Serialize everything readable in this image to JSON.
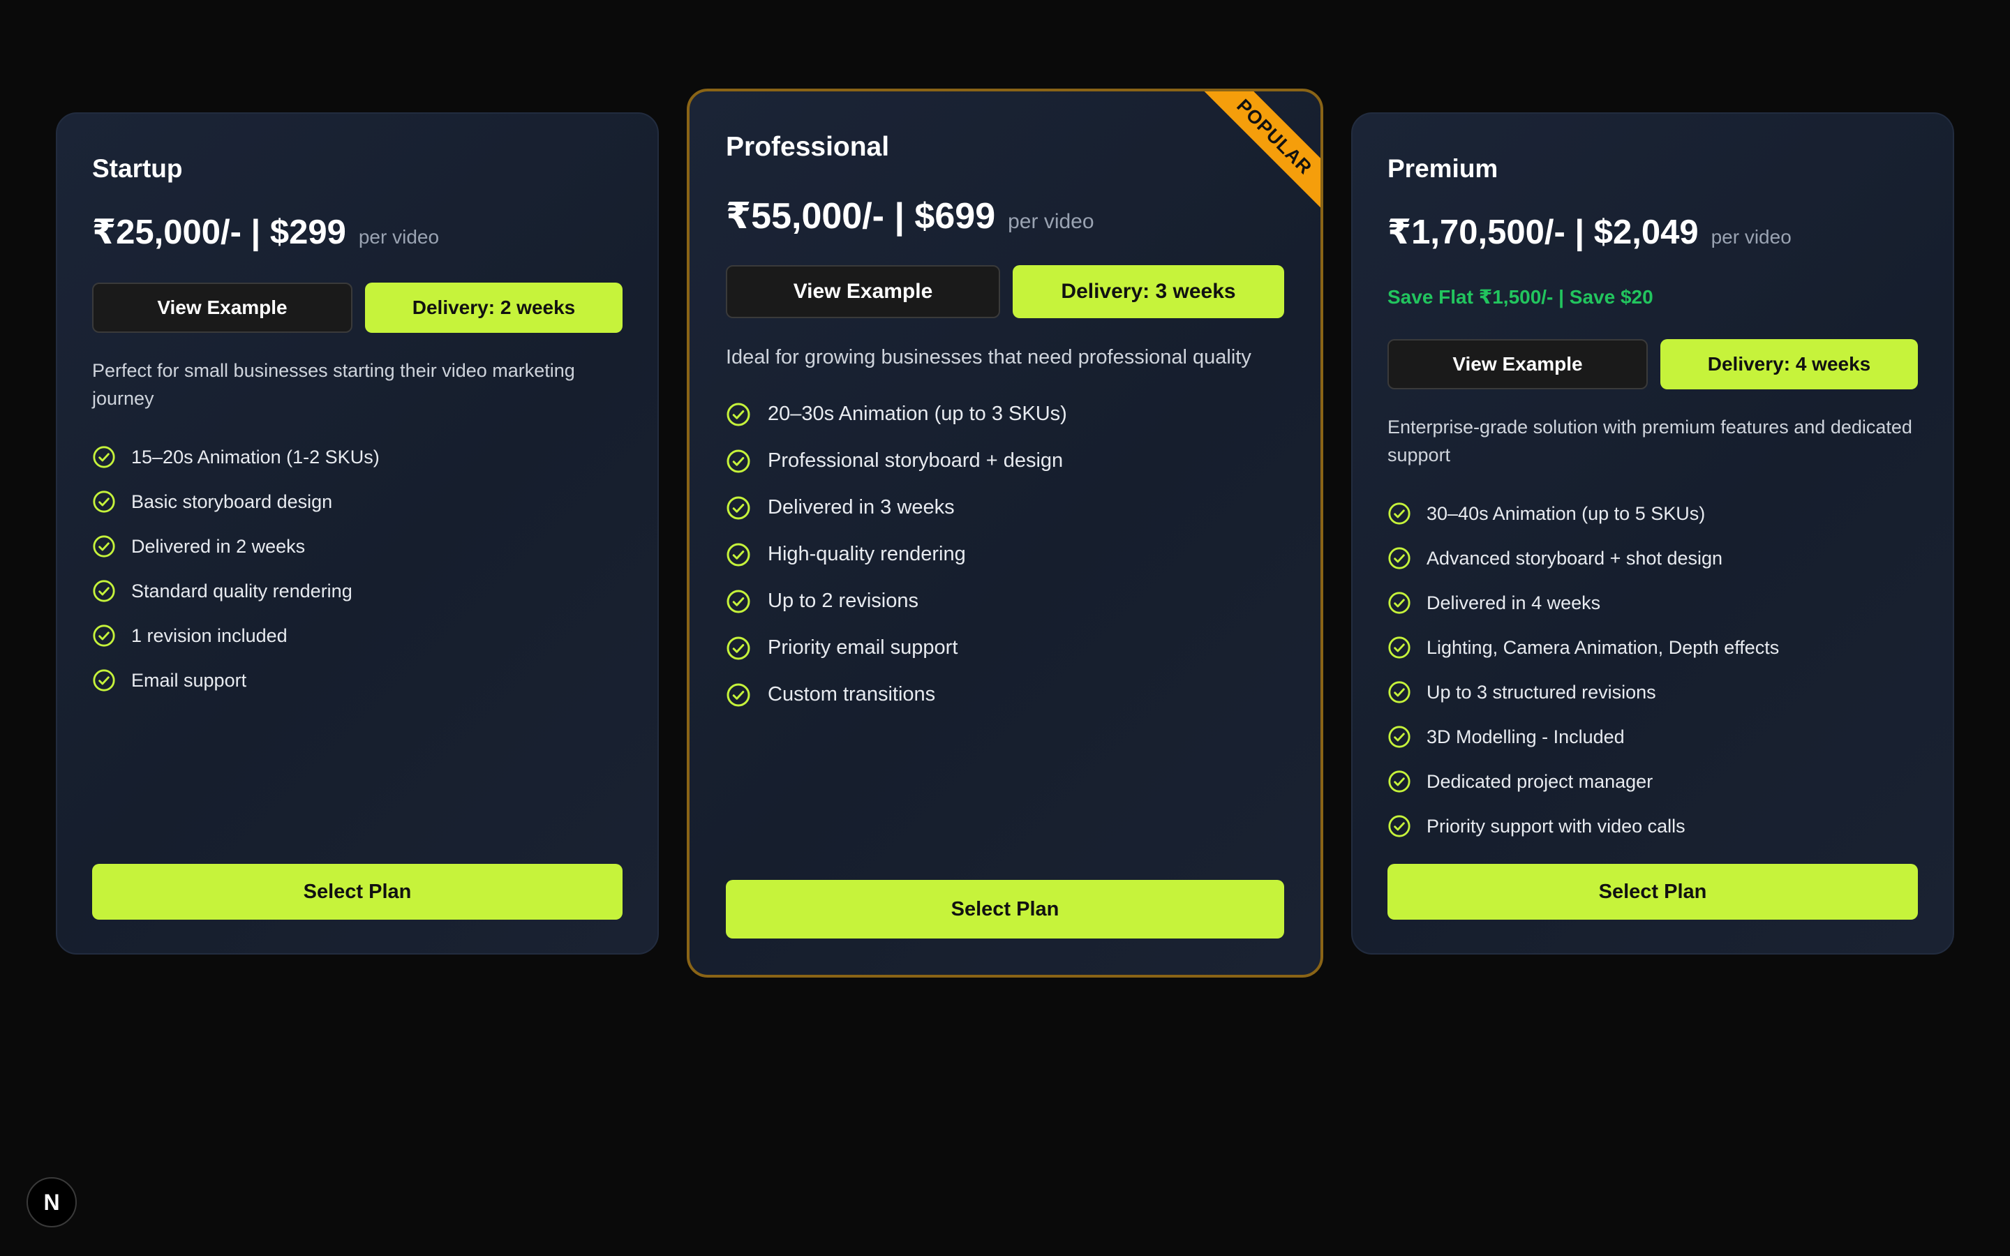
{
  "colors": {
    "accent": "#c6f33b",
    "save_green": "#22c55e",
    "popular_ribbon": "#f59e0b",
    "popular_border": "#8a6416",
    "background": "#0a0a0a",
    "card": "#1b2436"
  },
  "plans": [
    {
      "name": "Startup",
      "price": "₹25,000/- | $299",
      "per": "per video",
      "view_example_label": "View Example",
      "delivery_label": "Delivery: 2 weeks",
      "description": "Perfect for small businesses starting their video marketing journey",
      "features": [
        "15–20s Animation (1-2 SKUs)",
        "Basic storyboard design",
        "Delivered in 2 weeks",
        "Standard quality rendering",
        "1 revision included",
        "Email support"
      ],
      "select_label": "Select Plan"
    },
    {
      "name": "Professional",
      "badge": "POPULAR",
      "price": "₹55,000/- | $699",
      "per": "per video",
      "view_example_label": "View Example",
      "delivery_label": "Delivery: 3 weeks",
      "description": "Ideal for growing businesses that need professional quality",
      "features": [
        "20–30s Animation (up to 3 SKUs)",
        "Professional storyboard + design",
        "Delivered in 3 weeks",
        "High-quality rendering",
        "Up to 2 revisions",
        "Priority email support",
        "Custom transitions"
      ],
      "select_label": "Select Plan"
    },
    {
      "name": "Premium",
      "price": "₹1,70,500/- | $2,049",
      "per": "per video",
      "save_text": "Save Flat ₹1,500/- | Save $20",
      "view_example_label": "View Example",
      "delivery_label": "Delivery: 4 weeks",
      "description": "Enterprise-grade solution with premium features and dedicated support",
      "features": [
        "30–40s Animation (up to 5 SKUs)",
        "Advanced storyboard + shot design",
        "Delivered in 4 weeks",
        "Lighting, Camera Animation, Depth effects",
        "Up to 3 structured revisions",
        "3D Modelling - Included",
        "Dedicated project manager",
        "Priority support with video calls"
      ],
      "select_label": "Select Plan"
    }
  ],
  "dev_badge": {
    "letter": "N",
    "icon": "nextjs-logo-icon"
  }
}
